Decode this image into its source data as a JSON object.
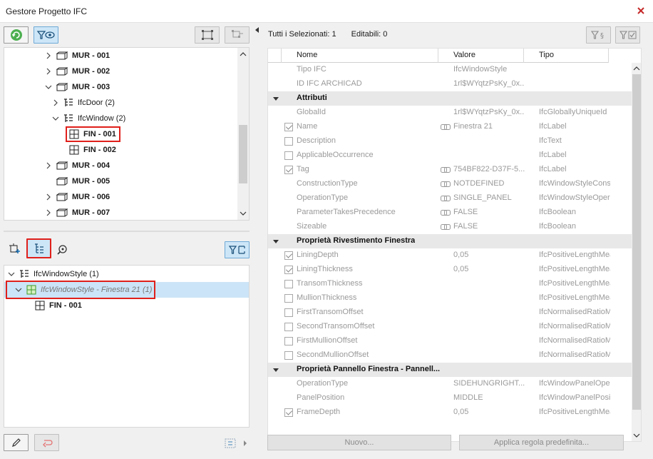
{
  "window": {
    "title": "Gestore Progetto IFC"
  },
  "tree_top": {
    "rows": [
      {
        "label": "MUR - 001"
      },
      {
        "label": "MUR - 002"
      },
      {
        "label": "MUR - 003"
      },
      {
        "label": "IfcDoor (2)"
      },
      {
        "label": "IfcWindow (2)"
      },
      {
        "label": "FIN - 001"
      },
      {
        "label": "FIN - 002"
      },
      {
        "label": "MUR - 004"
      },
      {
        "label": "MUR - 005"
      },
      {
        "label": "MUR - 006"
      },
      {
        "label": "MUR - 007"
      }
    ]
  },
  "tree_bottom": {
    "rows": [
      {
        "label": "IfcWindowStyle (1)"
      },
      {
        "label": "IfcWindowStyle - Finestra 21 (1)"
      },
      {
        "label": "FIN - 001"
      }
    ]
  },
  "info": {
    "selected": "Tutti i Selezionati: 1",
    "editable": "Editabili: 0"
  },
  "grid": {
    "headers": {
      "name": "Nome",
      "value": "Valore",
      "type": "Tipo"
    },
    "rows": [
      {
        "kind": "plain",
        "name": "Tipo IFC",
        "value": "IfcWindowStyle",
        "type": ""
      },
      {
        "kind": "plain",
        "name": "ID IFC ARCHICAD",
        "value": "1rl$WYqtzPsKy_0x...",
        "type": ""
      },
      {
        "kind": "section",
        "name": "Attributi"
      },
      {
        "kind": "plain",
        "name": "GlobalId",
        "value": "1rl$WYqtzPsKy_0x...",
        "type": "IfcGloballyUniqueId"
      },
      {
        "kind": "check",
        "checked": true,
        "link": true,
        "name": "Name",
        "value": "Finestra 21",
        "type": "IfcLabel"
      },
      {
        "kind": "check",
        "checked": false,
        "link": false,
        "name": "Description",
        "value": "",
        "type": "IfcText"
      },
      {
        "kind": "check",
        "checked": false,
        "link": false,
        "name": "ApplicableOccurrence",
        "value": "",
        "type": "IfcLabel"
      },
      {
        "kind": "check",
        "checked": true,
        "link": true,
        "name": "Tag",
        "value": "754BF822-D37F-5...",
        "type": "IfcLabel"
      },
      {
        "kind": "plain",
        "link": true,
        "name": "ConstructionType",
        "value": "NOTDEFINED",
        "type": "IfcWindowStyleConstructionEnum"
      },
      {
        "kind": "plain",
        "link": true,
        "name": "OperationType",
        "value": "SINGLE_PANEL",
        "type": "IfcWindowStyleOperationEnum"
      },
      {
        "kind": "plain",
        "link": true,
        "name": "ParameterTakesPrecedence",
        "value": "FALSE",
        "type": "IfcBoolean"
      },
      {
        "kind": "plain",
        "link": true,
        "name": "Sizeable",
        "value": "FALSE",
        "type": "IfcBoolean"
      },
      {
        "kind": "section",
        "name": "Proprietà Rivestimento Finestra"
      },
      {
        "kind": "check",
        "checked": true,
        "link": false,
        "name": "LiningDepth",
        "value": "0,05",
        "type": "IfcPositiveLengthMeasure"
      },
      {
        "kind": "check",
        "checked": true,
        "link": false,
        "name": "LiningThickness",
        "value": "0,05",
        "type": "IfcPositiveLengthMeasure"
      },
      {
        "kind": "check",
        "checked": false,
        "link": false,
        "name": "TransomThickness",
        "value": "",
        "type": "IfcPositiveLengthMeasure"
      },
      {
        "kind": "check",
        "checked": false,
        "link": false,
        "name": "MullionThickness",
        "value": "",
        "type": "IfcPositiveLengthMeasure"
      },
      {
        "kind": "check",
        "checked": false,
        "link": false,
        "name": "FirstTransomOffset",
        "value": "",
        "type": "IfcNormalisedRatioMeasure"
      },
      {
        "kind": "check",
        "checked": false,
        "link": false,
        "name": "SecondTransomOffset",
        "value": "",
        "type": "IfcNormalisedRatioMeasure"
      },
      {
        "kind": "check",
        "checked": false,
        "link": false,
        "name": "FirstMullionOffset",
        "value": "",
        "type": "IfcNormalisedRatioMeasure"
      },
      {
        "kind": "check",
        "checked": false,
        "link": false,
        "name": "SecondMullionOffset",
        "value": "",
        "type": "IfcNormalisedRatioMeasure"
      },
      {
        "kind": "section",
        "name": "Proprietà Pannello Finestra - Pannell..."
      },
      {
        "kind": "plain",
        "link": false,
        "name": "OperationType",
        "value": "SIDEHUNGRIGHT...",
        "type": "IfcWindowPanelOperationEnum"
      },
      {
        "kind": "plain",
        "link": false,
        "name": "PanelPosition",
        "value": "MIDDLE",
        "type": "IfcWindowPanelPositionEnum"
      },
      {
        "kind": "check",
        "checked": true,
        "link": false,
        "name": "FrameDepth",
        "value": "0,05",
        "type": "IfcPositiveLengthMeasure"
      }
    ]
  },
  "buttons": {
    "new": "Nuovo...",
    "apply": "Applica regola predefinita..."
  }
}
